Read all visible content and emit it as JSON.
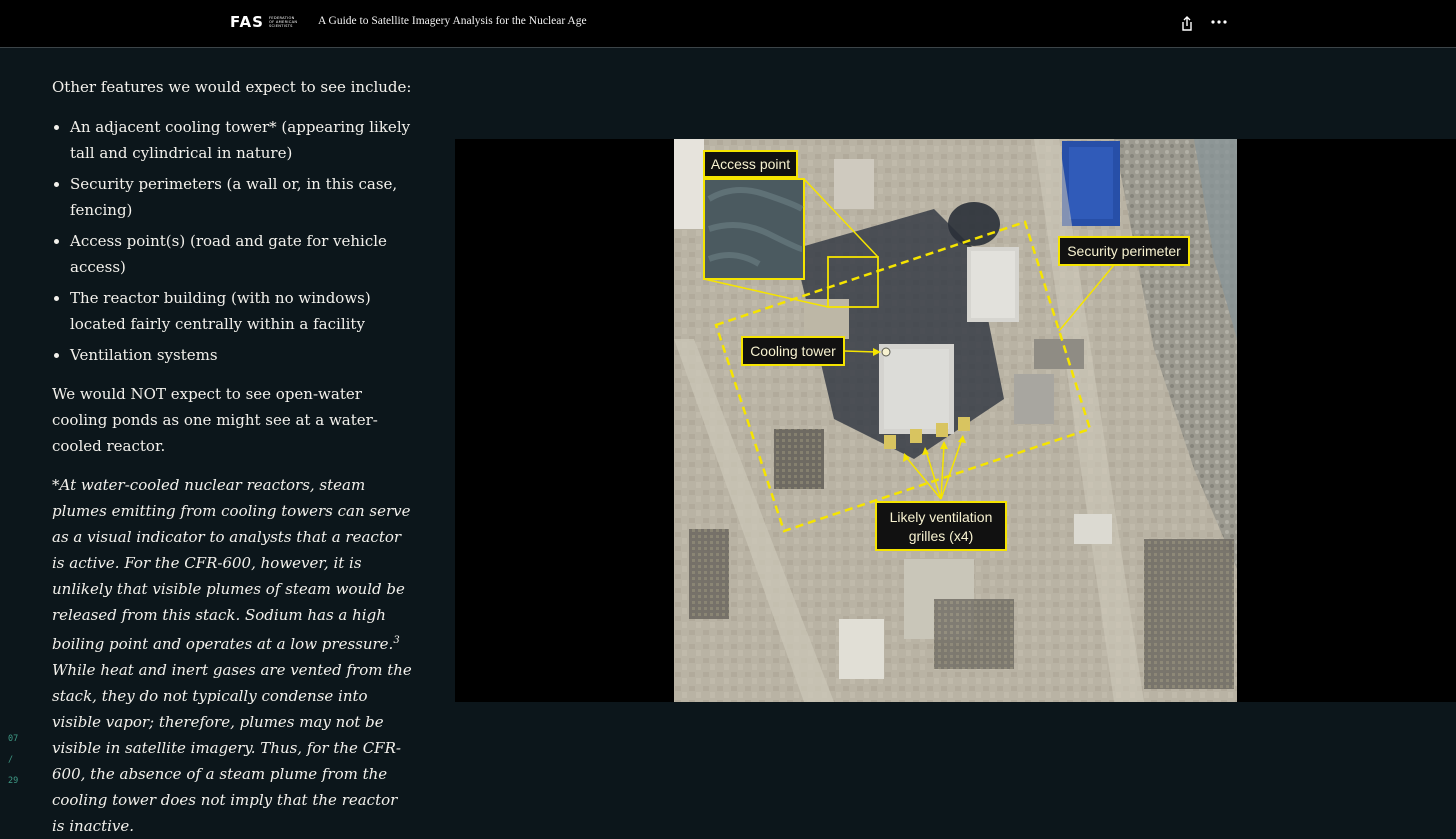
{
  "header": {
    "logo": {
      "mark": "FAS",
      "subtitle_lines": [
        "FEDERATION",
        "OF AMERICAN",
        "SCIENTISTS"
      ]
    },
    "title": "A Guide to Satellite Imagery Analysis for the Nuclear Age",
    "share_icon": "share-icon",
    "more_icon": "more-dots-icon"
  },
  "content": {
    "intro": "Other features we would expect to see include:",
    "features": [
      "An adjacent cooling tower* (appearing likely tall and cylindrical in nature)",
      "Security perimeters (a wall or, in this case, fencing)",
      "Access point(s) (road and gate for vehicle access)",
      "The reactor building (with no windows) located fairly centrally within a facility",
      "Ventilation systems"
    ],
    "not_expect": "We would NOT expect to see open-water cooling ponds as one might see at a water-cooled reactor.",
    "note_part1": "*At water-cooled nuclear reactors, steam plumes emitting from cooling towers can serve as a visual indicator to analysts that a reactor is active. For the CFR-600, however, it is unlikely that visible plumes of steam would be released from this stack. Sodium has a high boiling point and operates at a low pressure.",
    "note_sup": "3",
    "note_part2": " While heat and inert gases are vented from the stack, they do not typically condense into visible vapor; therefore, plumes may not be visible in satellite imagery. Thus, for the CFR-600, the absence of a steam plume from the cooling tower does not imply that the reactor is inactive."
  },
  "figure": {
    "labels": {
      "access_point": "Access point",
      "security_perimeter": "Security perimeter",
      "cooling_tower": "Cooling tower",
      "ventilation_line1": "Likely ventilation",
      "ventilation_line2": "grilles (x4)"
    },
    "annotation_color": "#f5e400"
  },
  "pager": {
    "current": "07",
    "separator": "/",
    "total": "29"
  }
}
